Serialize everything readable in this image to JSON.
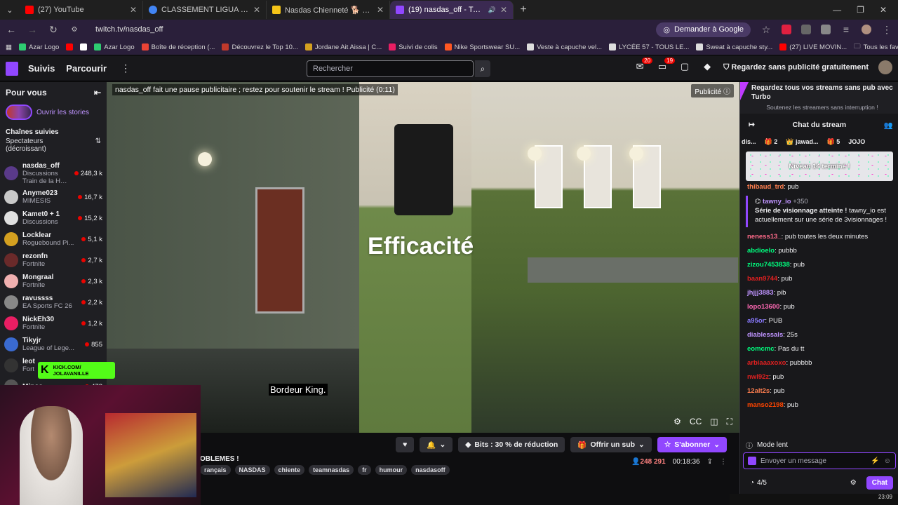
{
  "browser": {
    "tabs": [
      {
        "title": "(27) YouTube",
        "color": "#ff0000"
      },
      {
        "title": "CLASSEMENT LIGUA - Recherche",
        "color": "#4285f4"
      },
      {
        "title": "Nasdas Chienneté 🐕 (@nasdas",
        "color": "#f5c518"
      },
      {
        "title": "(19) nasdas_off - Twitch",
        "color": "#9147ff"
      }
    ],
    "url": "twitch.tv/nasdas_off",
    "google_button": "Demander à Google",
    "bookmarks": [
      "Azar Logo",
      "",
      "",
      "Azar Logo",
      "Boîte de réception (...",
      "Découvrez le Top 10...",
      "Jordane Ait Aissa | C...",
      "Suivi de colis",
      "Nike Sportswear SU...",
      "Veste à capuche vel...",
      "LYCÉE 57 - TOUS LE...",
      "Sweat à capuche sty...",
      "(27) LIVE MOVIN..."
    ],
    "bookmarks_all": "Tous les favoris"
  },
  "twitch": {
    "nav": {
      "following": "Suivis",
      "browse": "Parcourir",
      "search_placeholder": "Rechercher",
      "badge_notifications": "20",
      "badge_inbox": "19",
      "turbo": "Regardez sans publicité gratuitement"
    },
    "sidebar": {
      "title": "Pour vous",
      "stories": "Ouvrir les stories",
      "followed": "Chaînes suivies",
      "sort": "Spectateurs (décroissant)",
      "channels": [
        {
          "name": "nasdas_off",
          "game": "Discussions",
          "viewers": "248,3 k",
          "extra": "Train de la Hype •...",
          "color": "#5a3a8a"
        },
        {
          "name": "Anyme023",
          "game": "MIMESIS",
          "viewers": "16,7 k",
          "color": "#c9c9c9"
        },
        {
          "name": "Kamet0 + 1",
          "game": "Discussions",
          "viewers": "15,2 k",
          "color": "#e0e0e0"
        },
        {
          "name": "Locklear",
          "game": "Roguebound Pi...",
          "viewers": "5,1 k",
          "color": "#d4a020"
        },
        {
          "name": "rezonfn",
          "game": "Fortnite",
          "viewers": "2,7 k",
          "color": "#6a2a2a"
        },
        {
          "name": "Mongraal",
          "game": "Fortnite",
          "viewers": "2,3 k",
          "color": "#f0b0b0"
        },
        {
          "name": "ravussss",
          "game": "EA Sports FC 26",
          "viewers": "2,2 k",
          "color": "#888"
        },
        {
          "name": "NickEh30",
          "game": "Fortnite",
          "viewers": "1,2 k",
          "color": "#e91e63"
        },
        {
          "name": "Tikyjr",
          "game": "League of Lege...",
          "viewers": "855",
          "color": "#3a6ad0"
        },
        {
          "name": "leot",
          "game": "Fort",
          "viewers": "",
          "color": "#333"
        },
        {
          "name": "Minos",
          "game": "",
          "viewers": "478",
          "color": "#555"
        }
      ]
    },
    "video": {
      "ad_notice": "nasdas_off fait une pause publicitaire ; restez pour soutenir le stream ! Publicité (0:11)",
      "pub_label": "Publicité",
      "overlay": "Efficacité",
      "subtitle": "Bordeur King."
    },
    "kick": {
      "line1": "KICK.COM/",
      "line2": "JOLAVANILLE"
    },
    "info": {
      "title_fragment": "OBLEMES !",
      "bits": "Bits : 30 % de réduction",
      "gift": "Offrir un sub",
      "subscribe": "S'abonner",
      "viewers": "248 291",
      "uptime": "00:18:36",
      "tags": [
        "rançais",
        "NASDAS",
        "chiente",
        "teamnasdas",
        "fr",
        "humour",
        "nasdasoff"
      ]
    },
    "chat": {
      "turbo_title": "Regardez tous vos streams sans pub avec Turbo",
      "turbo_sub": "Soutenez les streamers sans interruption !",
      "header": "Chat du stream",
      "gifts": [
        "dis...",
        "2",
        "jawad...",
        "5",
        "JOJO"
      ],
      "level": "Niveau 14 terminé !",
      "messages": [
        {
          "user": "thibaud_trd",
          "text": ": pub",
          "color": "#ff7f50"
        },
        {
          "user": "neness13_",
          "text": ": pub toutes les deux minutes",
          "color": "#ff6b8a"
        },
        {
          "user": "abdioelo",
          "text": ": pubbb",
          "color": "#00ff7f"
        },
        {
          "user": "zizou7453838",
          "text": ": pub",
          "color": "#00ff7f"
        },
        {
          "user": "baan9744",
          "text": ": pub",
          "color": "#e02020"
        },
        {
          "user": "jhjjj3883",
          "text": ": pib",
          "color": "#bf94ff"
        },
        {
          "user": "lopo13600",
          "text": ": pub",
          "color": "#ff69b4"
        },
        {
          "user": "a95or",
          "text": ": PUB",
          "color": "#8a7aff"
        },
        {
          "user": "diablessals",
          "text": ": 25s",
          "color": "#bf94ff"
        },
        {
          "user": "eomcmc",
          "text": ": Pas du tt",
          "color": "#00ff7f"
        },
        {
          "user": "arbiaaaxoxo",
          "text": ": pubbbb",
          "color": "#e02020"
        },
        {
          "user": "nwl92z",
          "text": ": pub",
          "color": "#e02020"
        },
        {
          "user": "12alt2s",
          "text": ": pub",
          "color": "#ff7f50"
        },
        {
          "user": "manso2198",
          "text": ": pub",
          "color": "#ff4500"
        }
      ],
      "streak": {
        "user": "tawny_io",
        "points": "+350",
        "title": "Série de visionnage atteinte !",
        "body": "tawny_io est actuellement sur une série de 3visionnages !"
      },
      "slow_mode": "Mode lent",
      "input_placeholder": "Envoyer un message",
      "points": "4/5",
      "send": "Chat"
    },
    "clock": "23:09"
  }
}
